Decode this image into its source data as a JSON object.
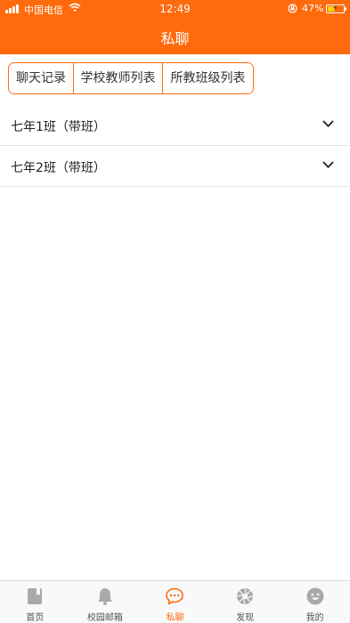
{
  "colors": {
    "accent": "#ff6a0d",
    "icon_inactive": "#a9a9a9"
  },
  "status_bar": {
    "carrier": "中国电信",
    "time": "12:49",
    "battery_percent": "47%",
    "battery_level": 0.47
  },
  "header": {
    "title": "私聊"
  },
  "tabs": [
    {
      "label": "聊天记录",
      "active": false
    },
    {
      "label": "学校教师列表",
      "active": false
    },
    {
      "label": "所教班级列表",
      "active": true
    }
  ],
  "class_list": [
    {
      "label": "七年1班（带班）",
      "icon": "chevron-down-icon"
    },
    {
      "label": "七年2班（带班）",
      "icon": "chevron-down-icon"
    }
  ],
  "tabbar": [
    {
      "label": "首页",
      "icon": "book-icon",
      "active": false
    },
    {
      "label": "校园邮箱",
      "icon": "bell-icon",
      "active": false
    },
    {
      "label": "私聊",
      "icon": "chat-bubble-icon",
      "active": true
    },
    {
      "label": "发现",
      "icon": "aperture-icon",
      "active": false
    },
    {
      "label": "我的",
      "icon": "smiley-icon",
      "active": false
    }
  ]
}
